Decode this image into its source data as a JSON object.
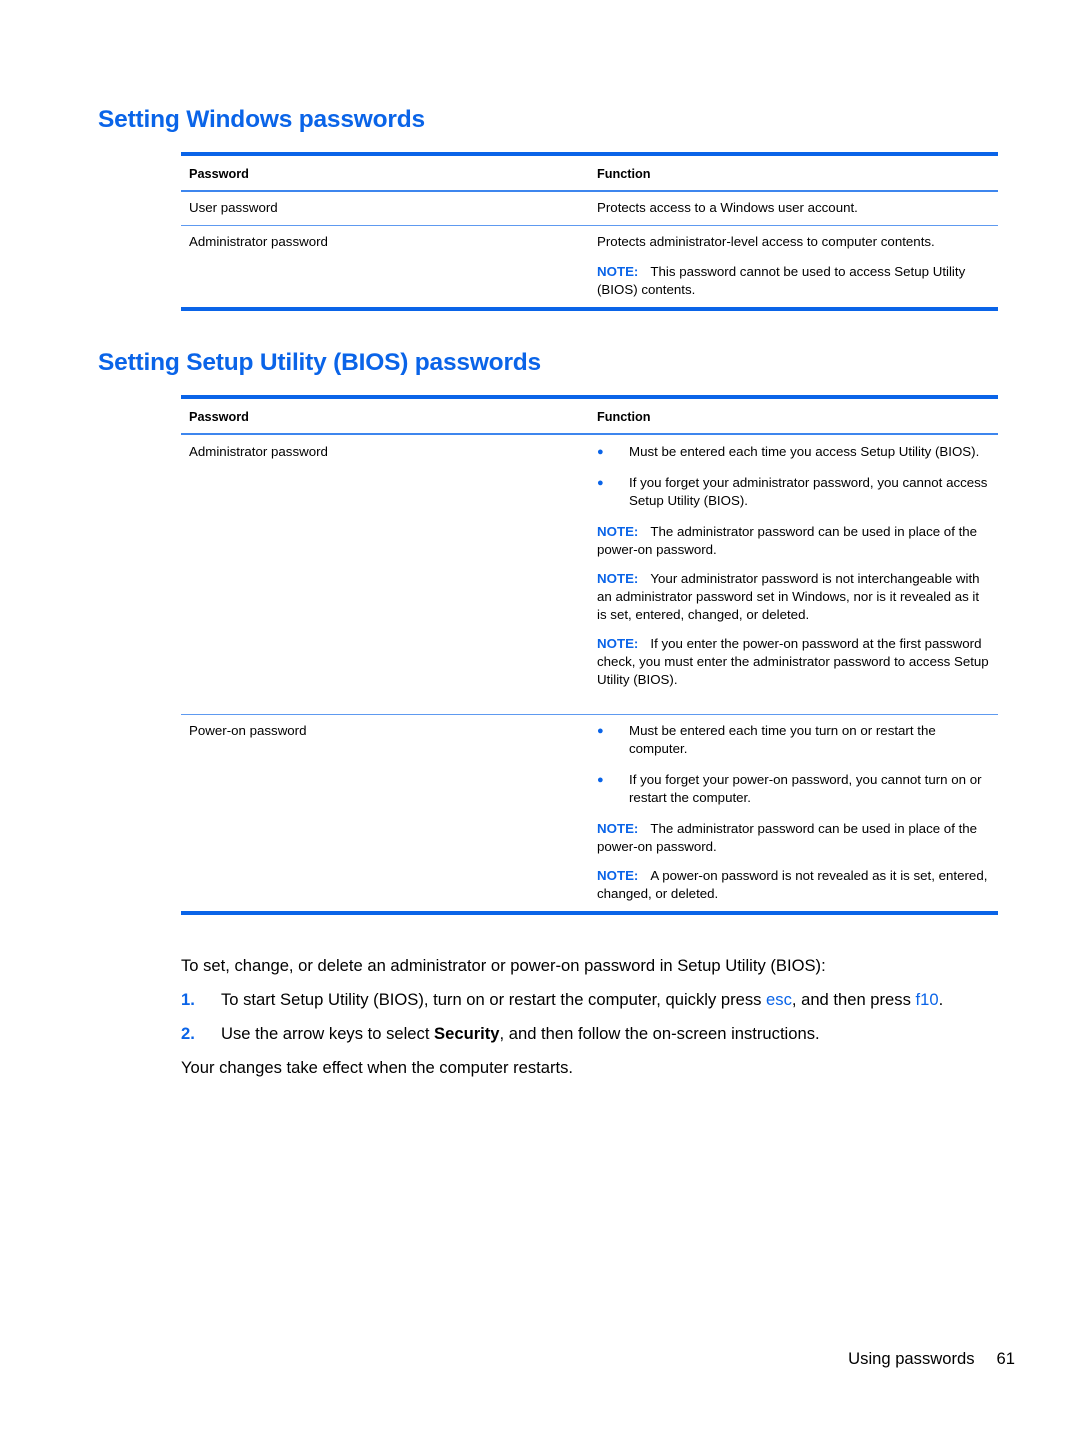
{
  "section1": {
    "title": "Setting Windows passwords",
    "headers": {
      "password": "Password",
      "function": "Function"
    },
    "rows": [
      {
        "password": "User password",
        "function": "Protects access to a Windows user account."
      },
      {
        "password": "Administrator password",
        "function": "Protects administrator-level access to computer contents.",
        "note_label": "NOTE:",
        "note_text": "This password cannot be used to access Setup Utility (BIOS) contents."
      }
    ]
  },
  "section2": {
    "title": "Setting Setup Utility (BIOS) passwords",
    "headers": {
      "password": "Password",
      "function": "Function"
    },
    "rows": [
      {
        "password": "Administrator password",
        "bullets": [
          "Must be entered each time you access Setup Utility (BIOS).",
          "If you forget your administrator password, you cannot access Setup Utility (BIOS)."
        ],
        "notes": [
          {
            "label": "NOTE:",
            "text": "The administrator password can be used in place of the power-on password."
          },
          {
            "label": "NOTE:",
            "text": "Your administrator password is not interchangeable with an administrator password set in Windows, nor is it revealed as it is set, entered, changed, or deleted."
          },
          {
            "label": "NOTE:",
            "text": "If you enter the power-on password at the first password check, you must enter the administrator password to access Setup Utility (BIOS)."
          }
        ]
      },
      {
        "password": "Power-on password",
        "bullets": [
          "Must be entered each time you turn on or restart the computer.",
          "If you forget your power-on password, you cannot turn on or restart the computer."
        ],
        "notes": [
          {
            "label": "NOTE:",
            "text": "The administrator password can be used in place of the power-on password."
          },
          {
            "label": "NOTE:",
            "text": "A power-on password is not revealed as it is set, entered, changed, or deleted."
          }
        ]
      }
    ]
  },
  "instructions": {
    "intro": "To set, change, or delete an administrator or power-on password in Setup Utility (BIOS):",
    "steps": [
      {
        "num": "1.",
        "text_a": "To start Setup Utility (BIOS), turn on or restart the computer, quickly press ",
        "key1": "esc",
        "text_b": ", and then press ",
        "key2": "f10",
        "text_c": "."
      },
      {
        "num": "2.",
        "text_a": "Use the arrow keys to select ",
        "bold": "Security",
        "text_b": ", and then follow the on-screen instructions."
      }
    ],
    "outro": "Your changes take effect when the computer restarts."
  },
  "footer": {
    "section": "Using passwords",
    "page": "61"
  }
}
